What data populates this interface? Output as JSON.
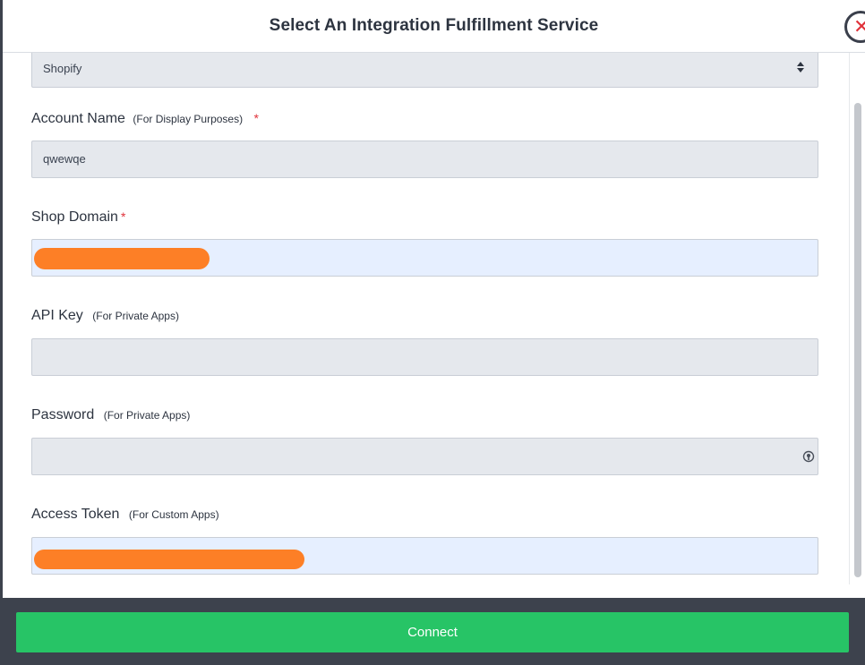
{
  "modal": {
    "title": "Select An Integration Fulfillment Service"
  },
  "fields": {
    "service_select": {
      "value": "Shopify"
    },
    "account_name": {
      "label": "Account Name",
      "hint": "(For Display Purposes)",
      "required_mark": "*",
      "value": "qwewqe"
    },
    "shop_domain": {
      "label": "Shop Domain",
      "required_mark": "*",
      "value_redacted": true
    },
    "api_key": {
      "label": "API Key",
      "hint": "(For Private Apps)",
      "value": ""
    },
    "password": {
      "label": "Password",
      "hint": "(For Private Apps)",
      "value": ""
    },
    "access_token": {
      "label": "Access Token",
      "hint": "(For Custom Apps)",
      "value_redacted": true
    }
  },
  "footer": {
    "connect_label": "Connect"
  },
  "colors": {
    "accent": "#27c466",
    "required": "#e0323a",
    "redaction": "#fd7f26",
    "backdrop": "#3d424d"
  },
  "icons": {
    "close": "close-icon",
    "select_arrows": "select-arrows-icon",
    "password_manager": "password-manager-icon"
  }
}
